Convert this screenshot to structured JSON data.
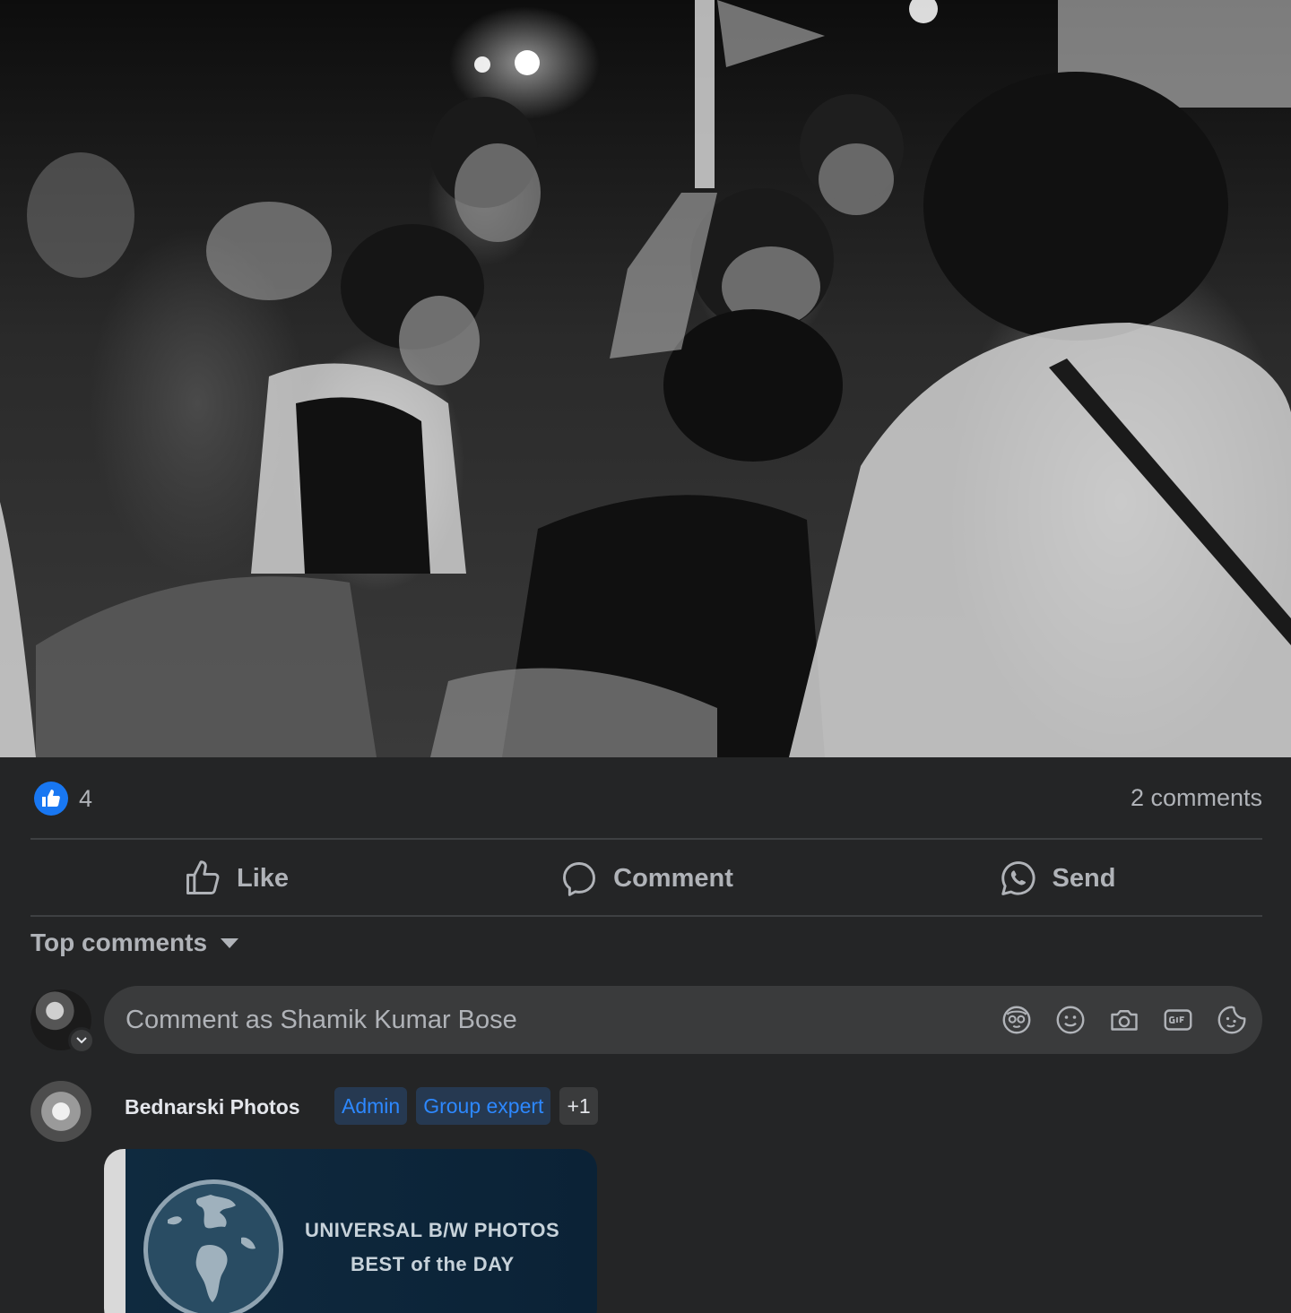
{
  "post": {
    "reaction_count": "4",
    "comment_count_text": "2 comments"
  },
  "actions": {
    "like_label": "Like",
    "comment_label": "Comment",
    "send_label": "Send"
  },
  "comments_sort": {
    "label": "Top comments"
  },
  "composer": {
    "placeholder": "Comment as Shamik Kumar Bose",
    "icons": [
      "avatar-sticker-icon",
      "emoji-icon",
      "camera-icon",
      "gif-icon",
      "sticker-icon"
    ]
  },
  "comment": {
    "author": "Bednarski Photos",
    "badges": [
      "Admin",
      "Group expert"
    ],
    "more_badges": "+1",
    "award": {
      "line1": "UNIVERSAL B/W PHOTOS",
      "line2": "BEST of the DAY"
    }
  },
  "colors": {
    "background": "#242526",
    "accent": "#1877f2",
    "badge_text": "#2d88ff",
    "secondary_text": "#b0b3b8"
  }
}
